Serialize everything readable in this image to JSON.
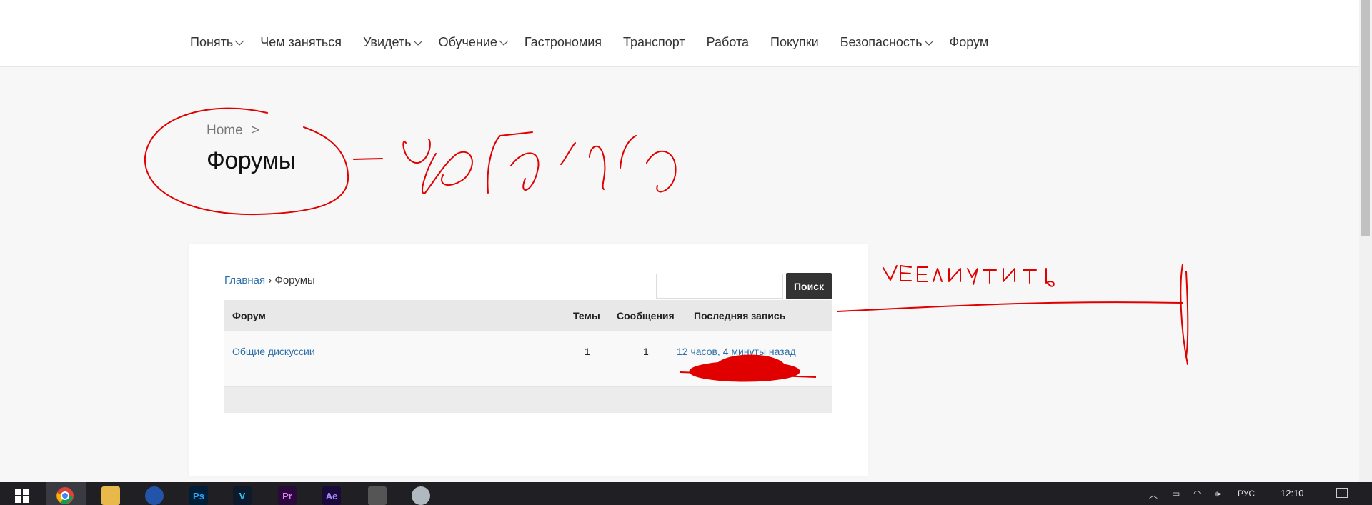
{
  "nav": {
    "items": [
      {
        "label": "Понять",
        "dropdown": true
      },
      {
        "label": "Чем заняться",
        "dropdown": false
      },
      {
        "label": "Увидеть",
        "dropdown": true
      },
      {
        "label": "Обучение",
        "dropdown": true
      },
      {
        "label": "Гастрономия",
        "dropdown": false
      },
      {
        "label": "Транспорт",
        "dropdown": false
      },
      {
        "label": "Работа",
        "dropdown": false
      },
      {
        "label": "Покупки",
        "dropdown": false
      },
      {
        "label": "Безопасность",
        "dropdown": true
      },
      {
        "label": "Форум",
        "dropdown": false
      }
    ]
  },
  "header": {
    "breadcrumb_home": "Home",
    "breadcrumb_sep": ">",
    "title": "Форумы"
  },
  "forum": {
    "breadcrumb": {
      "home": "Главная",
      "sep": "›",
      "current": "Форумы"
    },
    "search": {
      "button": "Поиск",
      "value": ""
    },
    "columns": [
      "Форум",
      "Темы",
      "Сообщения",
      "Последняя запись"
    ],
    "rows": [
      {
        "name": "Общие дискуссии",
        "topics": "1",
        "posts": "1",
        "last": "12 часов, 4 минуты назад"
      }
    ]
  },
  "taskbar": {
    "apps": [
      {
        "icon": "windows-start-icon"
      },
      {
        "icon": "chrome-icon"
      },
      {
        "icon": "file-explorer-icon"
      },
      {
        "icon": "media-app-icon"
      },
      {
        "icon": "photoshop-icon",
        "label": "Ps"
      },
      {
        "icon": "vegas-icon",
        "label": "V"
      },
      {
        "icon": "premiere-icon",
        "label": "Pr"
      },
      {
        "icon": "after-effects-icon",
        "label": "Ae"
      },
      {
        "icon": "calculator-icon"
      },
      {
        "icon": "app-icon"
      }
    ],
    "language": "РУС",
    "time": "12:10"
  },
  "colors": {
    "link": "#2c6fa8",
    "annotation": "#e00000",
    "button": "#333333"
  }
}
